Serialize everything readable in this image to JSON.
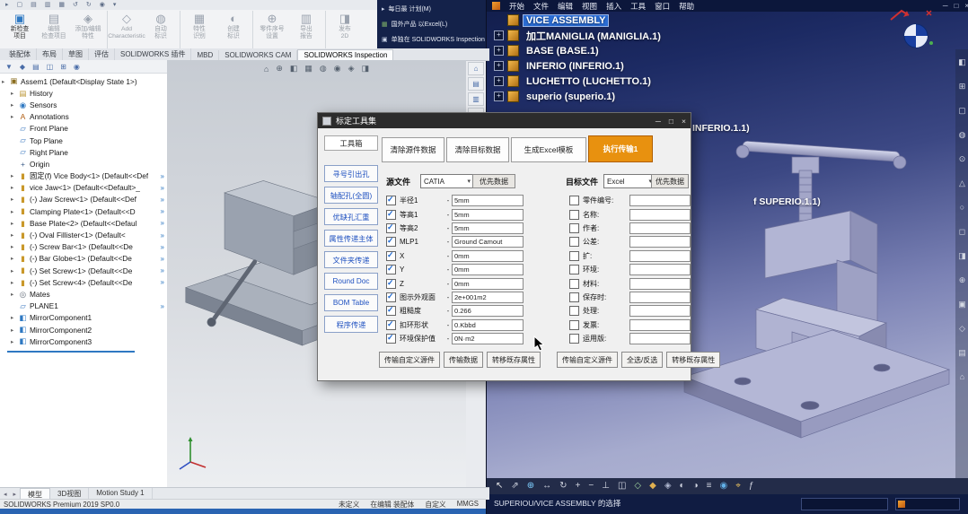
{
  "sw": {
    "quickbar_icons": [
      {
        "name": "menu-icon",
        "glyph": "▸"
      },
      {
        "name": "new-icon",
        "glyph": "▢"
      },
      {
        "name": "open-icon",
        "glyph": "▤"
      },
      {
        "name": "save-icon",
        "glyph": "▥"
      },
      {
        "name": "print-icon",
        "glyph": "▦"
      },
      {
        "name": "undo-icon",
        "glyph": "↺"
      },
      {
        "name": "redo-icon",
        "glyph": "↻"
      },
      {
        "name": "rebuild-icon",
        "glyph": "◉"
      },
      {
        "name": "options-icon",
        "glyph": "▾"
      }
    ],
    "ribbon_buttons": [
      {
        "label": "新检查\n项目",
        "icon": {
          "glyph": "▣",
          "color": "#2e78c2"
        },
        "enabled": true
      },
      {
        "label": "编辑\n检查项目",
        "icon": {
          "glyph": "▤",
          "color": "#9aa2ae"
        },
        "enabled": false
      },
      {
        "label": "添加/编辑\n特性",
        "icon": {
          "glyph": "◈",
          "color": "#9aa2ae"
        },
        "enabled": false,
        "group_end": true
      },
      {
        "label": "Add\nCharacteristic",
        "icon": {
          "glyph": "◇",
          "color": "#9aa2ae"
        },
        "enabled": false
      },
      {
        "label": "自动\n标识",
        "icon": {
          "glyph": "◍",
          "color": "#9aa2ae"
        },
        "enabled": false,
        "group_end": true
      },
      {
        "label": "特性\n识别",
        "icon": {
          "glyph": "▦",
          "color": "#9aa2ae"
        },
        "enabled": false
      },
      {
        "label": "创建\n标识",
        "icon": {
          "glyph": "◐",
          "color": "#9aa2ae"
        },
        "enabled": false,
        "group_end": true
      },
      {
        "label": "零件序号\n设置",
        "icon": {
          "glyph": "⊕",
          "color": "#9aa2ae"
        },
        "enabled": false
      },
      {
        "label": "导出\n报告",
        "icon": {
          "glyph": "▥",
          "color": "#9aa2ae"
        },
        "enabled": false,
        "group_end": true
      },
      {
        "label": "发布\n2D",
        "icon": {
          "glyph": "◨",
          "color": "#9aa2ae"
        },
        "enabled": false
      }
    ],
    "menu_dropdown_items": [
      {
        "label": "每日最 计划(M)",
        "icon": {
          "glyph": "▸",
          "color": "#cdd6ea"
        }
      },
      {
        "label": "国外产品 以Excel(L)",
        "icon": {
          "glyph": "▦",
          "color": "#7fb069"
        }
      },
      {
        "label": "单独在 SOLIDWORKS Inspection 项目",
        "icon": {
          "glyph": "▣",
          "color": "#cdd6ea"
        }
      }
    ],
    "tabs": [
      {
        "label": "装配体",
        "active": false
      },
      {
        "label": "布局",
        "active": false
      },
      {
        "label": "草图",
        "active": false
      },
      {
        "label": "评估",
        "active": false
      },
      {
        "label": "SOLIDWORKS 插件",
        "active": false
      },
      {
        "label": "MBD",
        "active": false
      },
      {
        "label": "SOLIDWORKS CAM",
        "active": false
      },
      {
        "label": "SOLIDWORKS Inspection",
        "active": true
      }
    ],
    "tree_toolbar_icons": [
      {
        "name": "filter-icon",
        "glyph": "▼"
      },
      {
        "name": "featuremanager-tree-icon",
        "glyph": "◆"
      },
      {
        "name": "property-manager-icon",
        "glyph": "▤"
      },
      {
        "name": "configuration-manager-icon",
        "glyph": "◫"
      },
      {
        "name": "dimxpert-manager-icon",
        "glyph": "⊞"
      },
      {
        "name": "display-manager-icon",
        "glyph": "◉"
      }
    ],
    "tree": [
      {
        "label": "Assem1 (Default<Display State 1>)",
        "icon": "asm",
        "indent": 0,
        "arrow": true
      },
      {
        "label": "History",
        "icon": "folder",
        "indent": 1,
        "arrow": true
      },
      {
        "label": "Sensors",
        "icon": "sensor",
        "indent": 1,
        "arrow": true
      },
      {
        "label": "Annotations",
        "icon": "ann",
        "indent": 1,
        "arrow": true
      },
      {
        "label": "Front Plane",
        "icon": "plane",
        "indent": 1,
        "arrow": false
      },
      {
        "label": "Top Plane",
        "icon": "plane",
        "indent": 1,
        "arrow": false
      },
      {
        "label": "Right Plane",
        "icon": "plane",
        "indent": 1,
        "arrow": false
      },
      {
        "label": "Origin",
        "icon": "origin",
        "indent": 1,
        "arrow": false
      },
      {
        "label": "固定(f) Vice Body<1> (Default<<Def",
        "icon": "part",
        "indent": 1,
        "arrow": true,
        "clip": true
      },
      {
        "label": "vice Jaw<1> (Default<<Default>_",
        "icon": "part",
        "indent": 1,
        "arrow": true,
        "clip": true
      },
      {
        "label": "(-) Jaw Screw<1> (Default<<Def",
        "icon": "part",
        "indent": 1,
        "arrow": true,
        "clip": true
      },
      {
        "label": "Clamping Plate<1> (Default<<D",
        "icon": "part",
        "indent": 1,
        "arrow": true,
        "clip": true
      },
      {
        "label": "Base Plate<2> (Default<<Defaul",
        "icon": "part",
        "indent": 1,
        "arrow": true,
        "clip": true
      },
      {
        "label": "(-) Oval Fillister<1> (Default<",
        "icon": "part",
        "indent": 1,
        "arrow": true,
        "clip": true
      },
      {
        "label": "(-) Screw Bar<1> (Default<<De",
        "icon": "part",
        "indent": 1,
        "arrow": true,
        "clip": true
      },
      {
        "label": "(-) Bar Globe<1> (Default<<De",
        "icon": "part",
        "indent": 1,
        "arrow": true,
        "clip": true
      },
      {
        "label": "(-) Set Screw<1> (Default<<De",
        "icon": "part",
        "indent": 1,
        "arrow": true,
        "clip": true
      },
      {
        "label": "(-) Set Screw<4> (Default<<De",
        "icon": "part",
        "indent": 1,
        "arrow": true,
        "clip": true
      },
      {
        "label": "Mates",
        "icon": "mates",
        "indent": 1,
        "arrow": true
      },
      {
        "label": "PLANE1",
        "icon": "plane",
        "indent": 1,
        "arrow": false,
        "clip": true
      },
      {
        "label": "MirrorComponent1",
        "icon": "mirror",
        "indent": 1,
        "arrow": true
      },
      {
        "label": "MirrorComponent2",
        "icon": "mirror",
        "indent": 1,
        "arrow": true
      },
      {
        "label": "MirrorComponent3",
        "icon": "mirror",
        "indent": 1,
        "arrow": true
      }
    ],
    "hud_icons": [
      {
        "name": "zoom-fit-icon",
        "glyph": "⌂"
      },
      {
        "name": "zoom-area-icon",
        "glyph": "⊕"
      },
      {
        "name": "section-view-icon",
        "glyph": "◧"
      },
      {
        "name": "view-orientation-icon",
        "glyph": "▦"
      },
      {
        "name": "display-style-icon",
        "glyph": "◍"
      },
      {
        "name": "hide-show-icon",
        "glyph": "◉"
      },
      {
        "name": "appearance-icon",
        "glyph": "◈"
      },
      {
        "name": "scene-icon",
        "glyph": "◨"
      }
    ],
    "taskpane_icons": [
      {
        "name": "resources-icon",
        "glyph": "⌂"
      },
      {
        "name": "design-library-icon",
        "glyph": "▤"
      },
      {
        "name": "file-explorer-icon",
        "glyph": "▥"
      },
      {
        "name": "appearances-icon",
        "glyph": "◈"
      },
      {
        "name": "custom-properties-icon",
        "glyph": "▦"
      }
    ],
    "nav_icons": [
      {
        "name": "prev-tab-icon",
        "glyph": "◂"
      },
      {
        "name": "next-tab-icon",
        "glyph": "▸"
      }
    ],
    "bottom_tabs": [
      {
        "label": "模型",
        "active": true
      },
      {
        "label": "3D视图",
        "active": false
      },
      {
        "label": "Motion Study 1",
        "active": false
      }
    ],
    "status": {
      "product": "SOLIDWORKS Premium 2019 SP0.0",
      "state": "未定义",
      "mode": "在编辑 装配体",
      "custom": "自定义",
      "units": "MMGS"
    }
  },
  "dialog": {
    "title": "标定工具集",
    "controls": [
      {
        "name": "minimize-icon",
        "glyph": "─"
      },
      {
        "name": "maximize-icon",
        "glyph": "□"
      },
      {
        "name": "close-icon",
        "glyph": "×"
      }
    ],
    "side_tab": "工具箱",
    "top_buttons": [
      {
        "label": "清除源件数据",
        "primary": false
      },
      {
        "label": "清除目标数据",
        "primary": false
      },
      {
        "label": "生成Excel模板",
        "primary": false
      },
      {
        "label": "执行传输1",
        "primary": true
      }
    ],
    "side_buttons": [
      "寻号引出孔",
      "轴配孔(全圆)",
      "优缺孔汇重",
      "属性传递主体",
      "文件夹传递",
      "Round Doc",
      "BOM Table",
      "程序传递"
    ],
    "row_separator": "-",
    "source": {
      "label": "源文件",
      "format": "CATIA",
      "action": "优先数据",
      "rows": [
        {
          "checked": true,
          "name": "半径1",
          "value": "5mm"
        },
        {
          "checked": true,
          "name": "等高1",
          "value": "5mm"
        },
        {
          "checked": true,
          "name": "等高2",
          "value": "5mm"
        },
        {
          "checked": true,
          "name": "MLP1",
          "value": "Ground Camout"
        },
        {
          "checked": true,
          "name": "X",
          "value": "0mm"
        },
        {
          "checked": true,
          "name": "Y",
          "value": "0mm"
        },
        {
          "checked": true,
          "name": "Z",
          "value": "0mm"
        },
        {
          "checked": true,
          "name": "图示外观面",
          "value": "2e+001m2"
        },
        {
          "checked": true,
          "name": "粗糙度",
          "value": "0.266"
        },
        {
          "checked": true,
          "name": "扣环形状",
          "value": "0.Kbbd"
        },
        {
          "checked": true,
          "name": "环境保护值",
          "value": "0N·m2"
        }
      ]
    },
    "target": {
      "label": "目标文件",
      "format": "Excel",
      "action": "优先数据",
      "rows": [
        {
          "checked": false,
          "name": "零件编号:",
          "value": ""
        },
        {
          "checked": false,
          "name": "名称:",
          "value": ""
        },
        {
          "checked": false,
          "name": "作者:",
          "value": ""
        },
        {
          "checked": false,
          "name": "公差:",
          "value": ""
        },
        {
          "checked": false,
          "name": "扩:",
          "value": ""
        },
        {
          "checked": false,
          "name": "环境:",
          "value": ""
        },
        {
          "checked": false,
          "name": "材料:",
          "value": ""
        },
        {
          "checked": false,
          "name": "保存时:",
          "value": ""
        },
        {
          "checked": false,
          "name": "处理:",
          "value": ""
        },
        {
          "checked": false,
          "name": "发票:",
          "value": ""
        },
        {
          "checked": false,
          "name": "运用版:",
          "value": ""
        }
      ]
    },
    "bottom_buttons": [
      "传输自定义源件",
      "传输数据",
      "转移既存属性",
      "传输自定义源件",
      "全选/反选",
      "转移既存属性"
    ]
  },
  "catia": {
    "menus": [
      "开始",
      "文件",
      "编辑",
      "视图",
      "插入",
      "工具",
      "窗口",
      "帮助"
    ],
    "window_controls": [
      {
        "name": "minimize-icon",
        "glyph": "─"
      },
      {
        "name": "restore-icon",
        "glyph": "□"
      },
      {
        "name": "close-icon",
        "glyph": "×"
      }
    ],
    "tree": [
      {
        "label": "VICE ASSEMBLY",
        "selected": true,
        "plus": false
      },
      {
        "label": "加工MANIGLIA (MANIGLIA.1)",
        "selected": false,
        "plus": true
      },
      {
        "label": "BASE (BASE.1)",
        "selected": false,
        "plus": true
      },
      {
        "label": "INFERIO (INFERIO.1)",
        "selected": false,
        "plus": true
      },
      {
        "label": "LUCHETTO (LUCHETTO.1)",
        "selected": false,
        "plus": true
      },
      {
        "label": "superio (superio.1)",
        "selected": false,
        "plus": true
      }
    ],
    "float_labels": [
      "INFERIO.1.1)",
      "f SUPERIO.1.1)"
    ],
    "right_toolbar_icons": [
      {
        "name": "select-icon",
        "glyph": "◧"
      },
      {
        "name": "product-structure-icon",
        "glyph": "⊞"
      },
      {
        "name": "plane-icon",
        "glyph": "▢"
      },
      {
        "name": "sketch-icon",
        "glyph": "◍"
      },
      {
        "name": "pad-icon",
        "glyph": "⊙"
      },
      {
        "name": "pocket-icon",
        "glyph": "△"
      },
      {
        "name": "hole-icon",
        "glyph": "○"
      },
      {
        "name": "fillet-icon",
        "glyph": "◻"
      },
      {
        "name": "chamfer-icon",
        "glyph": "◨"
      },
      {
        "name": "constraint-icon",
        "glyph": "⊕"
      },
      {
        "name": "measure-icon",
        "glyph": "▣"
      },
      {
        "name": "material-icon",
        "glyph": "◇"
      },
      {
        "name": "layers-icon",
        "glyph": "▤"
      },
      {
        "name": "home-icon",
        "glyph": "⌂"
      }
    ],
    "bottom_toolbar_icons": [
      {
        "name": "select-arrow-icon",
        "glyph": "↖",
        "color": "#e8e8e8"
      },
      {
        "name": "fly-mode-icon",
        "glyph": "⇗",
        "color": "#d0d4e0"
      },
      {
        "name": "fit-all-icon",
        "glyph": "⊕",
        "color": "#7fd0ff"
      },
      {
        "name": "pan-icon",
        "glyph": "↔",
        "color": "#d0d4e0"
      },
      {
        "name": "rotate-icon",
        "glyph": "↻",
        "color": "#d0d4e0"
      },
      {
        "name": "zoom-in-icon",
        "glyph": "+",
        "color": "#d0d4e0"
      },
      {
        "name": "zoom-out-icon",
        "glyph": "−",
        "color": "#d0d4e0"
      },
      {
        "name": "normal-view-icon",
        "glyph": "⊥",
        "color": "#d0d4e0"
      },
      {
        "name": "multi-view-icon",
        "glyph": "◫",
        "color": "#d0d4e0"
      },
      {
        "name": "iso-view-icon",
        "glyph": "◇",
        "color": "#9fd49f"
      },
      {
        "name": "shaded-icon",
        "glyph": "◆",
        "color": "#e0b050"
      },
      {
        "name": "wireframe-icon",
        "glyph": "◈",
        "color": "#b0b8d0"
      },
      {
        "name": "hide-show-icon",
        "glyph": "◐",
        "color": "#d0d4e0"
      },
      {
        "name": "swap-visible-icon",
        "glyph": "◑",
        "color": "#d0d4e0"
      },
      {
        "name": "graph-tree-icon",
        "glyph": "≡",
        "color": "#d0d4e0"
      },
      {
        "name": "world-icon",
        "glyph": "◉",
        "color": "#62b0e8"
      },
      {
        "name": "measure-icon",
        "glyph": "⌖",
        "color": "#e8c060"
      },
      {
        "name": "knowledge-icon",
        "glyph": "ƒ",
        "color": "#d0d4e0"
      }
    ],
    "status_left": "SUPERIOU/VICE ASSEMBLY 的选择"
  }
}
